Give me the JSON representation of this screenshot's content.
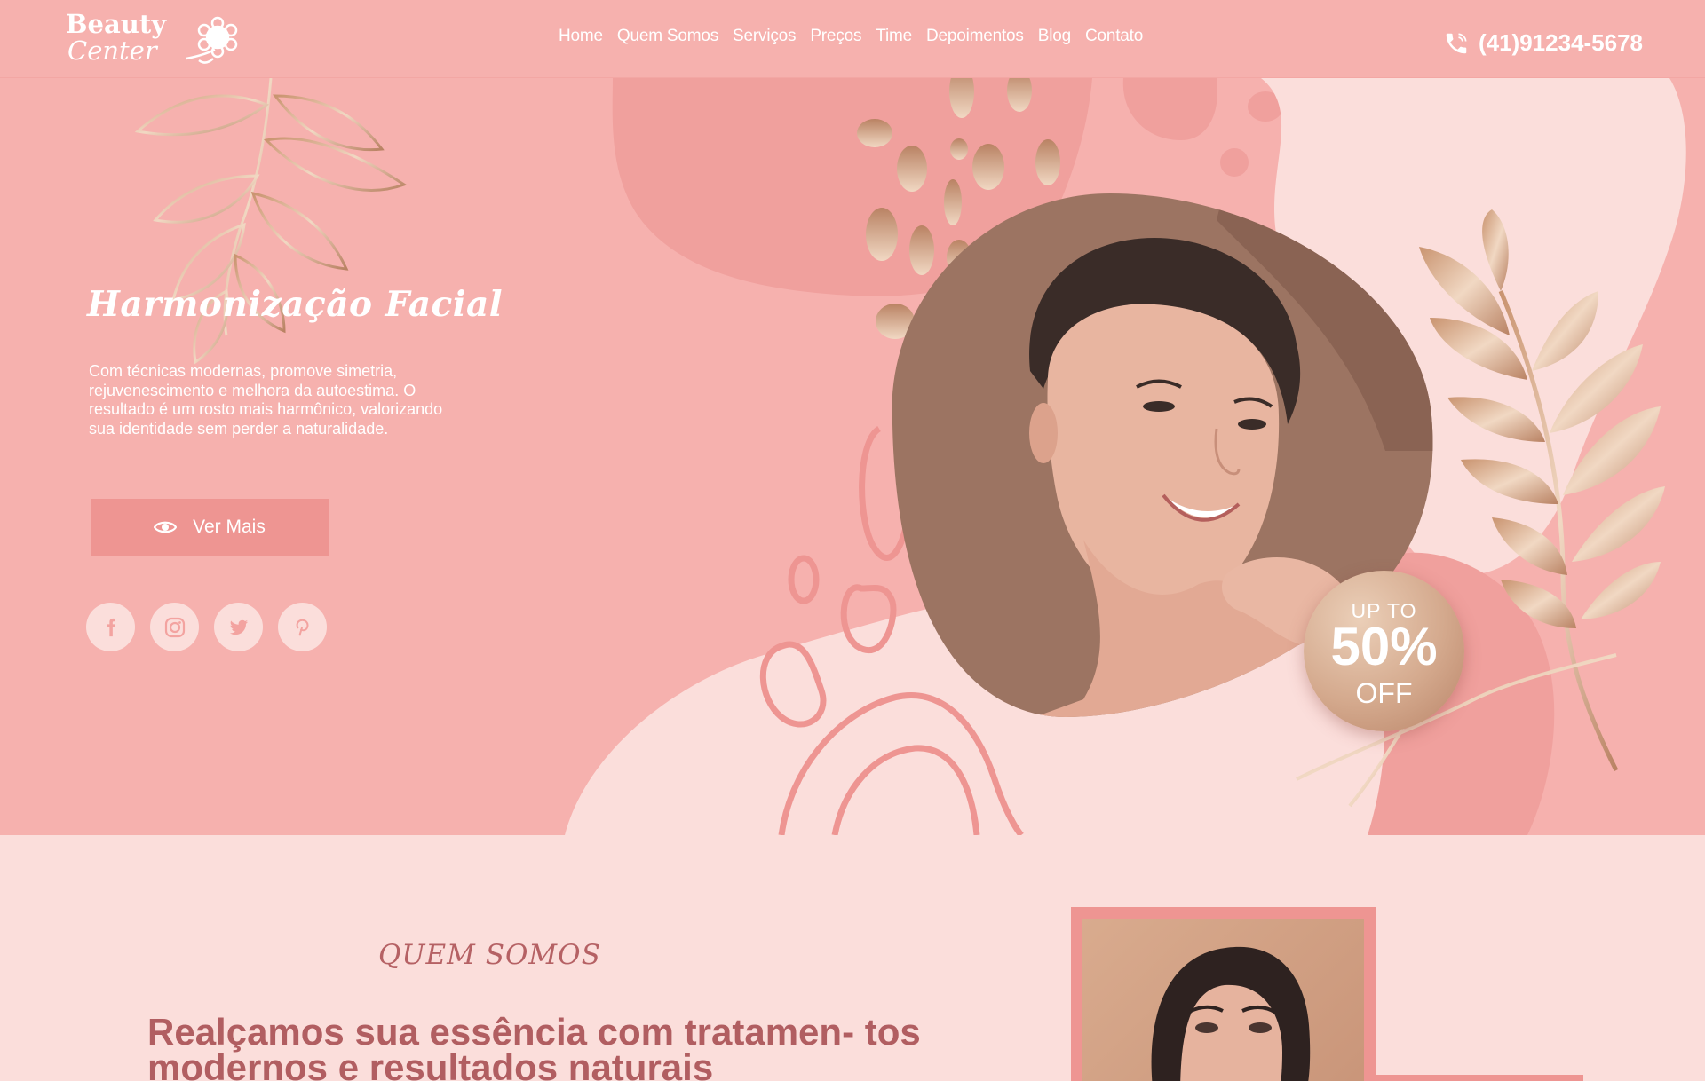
{
  "header": {
    "logo_line1": "Beauty",
    "logo_line2": "Center",
    "nav": [
      "Home",
      "Quem Somos",
      "Serviços",
      "Preços",
      "Time",
      "Depoimentos",
      "Blog",
      "Contato"
    ],
    "phone": "(41)91234-5678"
  },
  "hero": {
    "title": "Harmonização Facial",
    "description": "Com técnicas modernas, promove simetria, rejuvenescimento e melhora da autoestima. O resultado é um rosto mais harmônico, valorizando sua identidade sem perder a naturalidade.",
    "button_label": "Ver Mais",
    "socials": [
      "facebook-icon",
      "instagram-icon",
      "twitter-icon",
      "pinterest-icon"
    ],
    "badge": {
      "line1": "UP TO",
      "line2": "50%",
      "line3": "OFF"
    }
  },
  "about": {
    "eyebrow": "QUEM SOMOS",
    "heading": "Realçamos sua essência com tratamen- tos modernos e resultados naturais"
  },
  "colors": {
    "header_bg": "#f6b1ae",
    "hero_bg": "#f6b1ae",
    "blob_dark": "#f0a09d",
    "blob_light": "#fbdedb",
    "button_bg": "#ee9592",
    "heading_text": "#b15e61",
    "gold": "#d4a98d"
  }
}
